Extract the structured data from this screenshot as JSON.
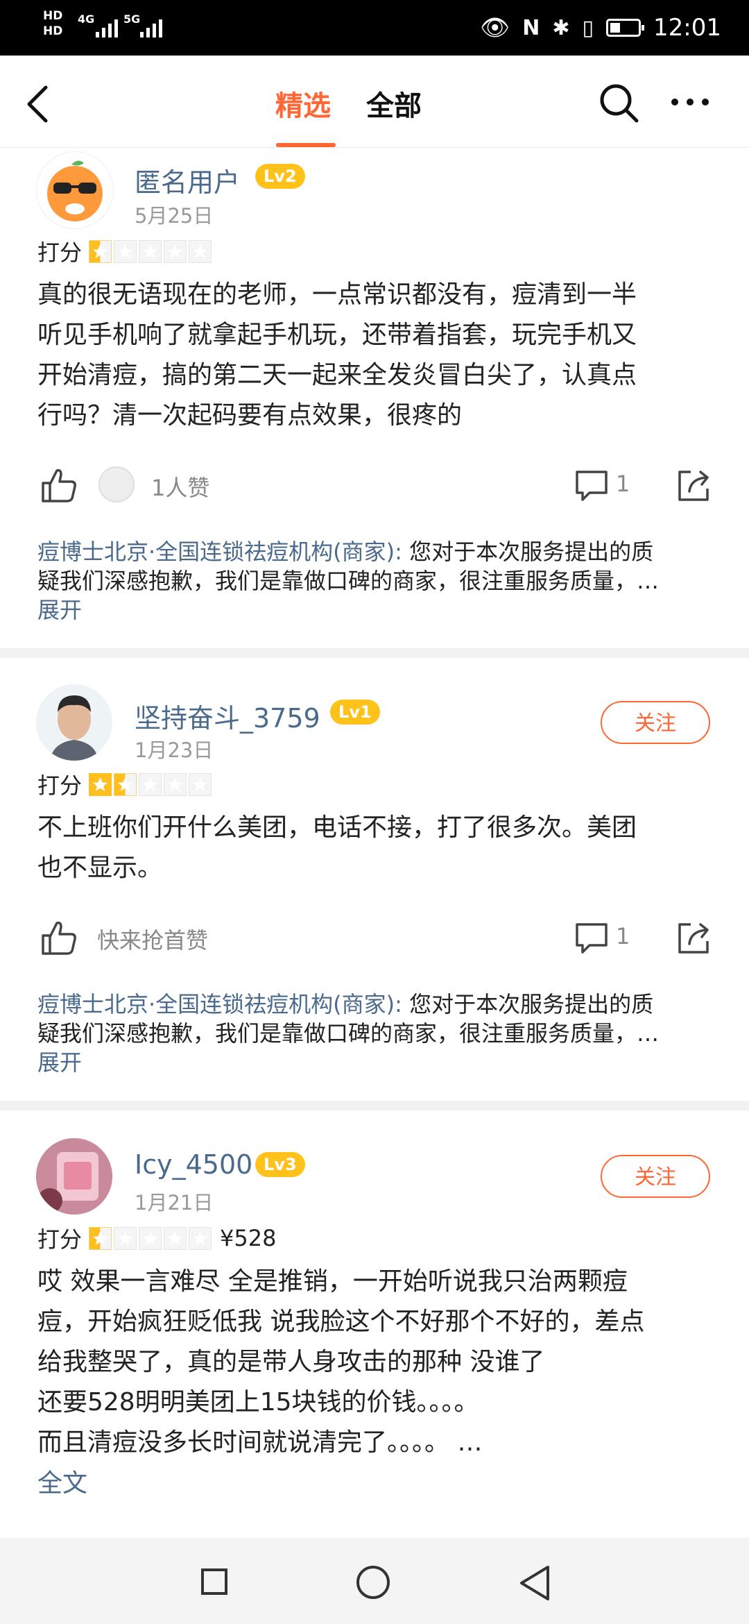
{
  "status_bar": {
    "hd1": "HD",
    "hd2": "HD",
    "net1": "4G",
    "net2": "5G",
    "time": "12:01"
  },
  "header": {
    "tab_selected": "精选",
    "tab_all": "全部",
    "accent_color": "#ff6633"
  },
  "reviews": [
    {
      "username": "匿名用户",
      "level": "Lv2",
      "date": "5月25日",
      "score_label": "打分",
      "rating": 0.5,
      "lines": [
        "真的很无语现在的老师，一点常识都没有，痘清到一半",
        "听见手机响了就拿起手机玩，还带着指套，玩完手机又",
        "开始清痘，搞的第二天一起来全发炎冒白尖了，认真点",
        "行吗？清一次起码要有点效果，很疼的"
      ],
      "like_text": "1人赞",
      "comment_count": "1",
      "reply_author": "痘博士北京·全国连锁祛痘机构(商家):",
      "reply_line1": " 您对于本次服务提出的质",
      "reply_line2": "疑我们深感抱歉，我们是靠做口碑的商家，很注重服务质量，…",
      "expand": "展开"
    },
    {
      "username": "坚持奋斗_3759",
      "level": "Lv1",
      "date": "1月23日",
      "follow": "关注",
      "score_label": "打分",
      "rating": 1.5,
      "lines": [
        "不上班你们开什么美团，电话不接，打了很多次。美团",
        "也不显示。"
      ],
      "like_text": "快来抢首赞",
      "comment_count": "1",
      "reply_author": "痘博士北京·全国连锁祛痘机构(商家):",
      "reply_line1": " 您对于本次服务提出的质",
      "reply_line2": "疑我们深感抱歉，我们是靠做口碑的商家，很注重服务质量，…",
      "expand": "展开"
    },
    {
      "username": "Icy_4500",
      "level": "Lv3",
      "date": "1月21日",
      "follow": "关注",
      "score_label": "打分",
      "rating": 0.5,
      "price": "¥528",
      "lines": [
        "哎 效果一言难尽 全是推销，一开始听说我只治两颗痘",
        "痘，开始疯狂贬低我 说我脸这个不好那个不好的，差点",
        "给我整哭了，真的是带人身攻击的那种 没谁了",
        "还要528明明美团上15块钱的价钱。。。。",
        "而且清痘没多长时间就说清完了。。。。 …"
      ],
      "full_text": "全文"
    }
  ]
}
